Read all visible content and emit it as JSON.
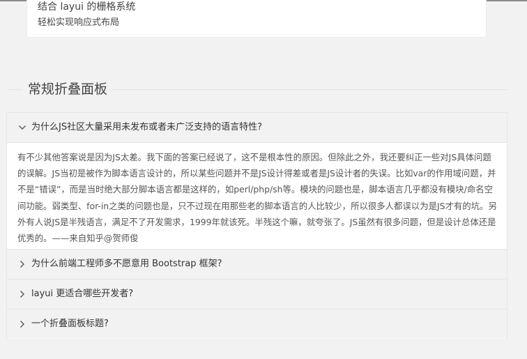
{
  "grid_card": {
    "line1": "结合 layui 的栅格系统",
    "line2": "轻松实现响应式布局"
  },
  "section": {
    "title": "常规折叠面板"
  },
  "collapse": {
    "items": [
      {
        "title": "为什么JS社区大量采用未发布或者未广泛支持的语言特性?",
        "expanded": true,
        "content": "有不少其他答案说是因为JS太差。我下面的答案已经说了，这不是根本性的原因。但除此之外，我还要纠正一些对JS具体问题的误解。JS当初是被作为脚本语言设计的，所以某些问题并不是JS设计得差或者是JS设计者的失误。比如var的作用域问题，并不是“错误”，而是当时绝大部分脚本语言都是这样的，如perl/php/sh等。模块的问题也是，脚本语言几乎都没有模块/命名空间功能。弱类型、for-in之类的问题也是，只不过现在用那些老的脚本语言的人比较少，所以很多人都误以为是JS才有的坑。另外有人说JS是半残语言，满足不了开发需求，1999年就该死。半残这个嘛，就夸张了。JS虽然有很多问题，但是设计总体还是优秀的。——来自知乎@贺师俊"
      },
      {
        "title": "为什么前端工程师多不愿意用 Bootstrap 框架?",
        "expanded": false
      },
      {
        "title": "layui 更适合哪些开发者?",
        "expanded": false
      },
      {
        "title": "一个折叠面板标题?",
        "expanded": false
      }
    ]
  }
}
